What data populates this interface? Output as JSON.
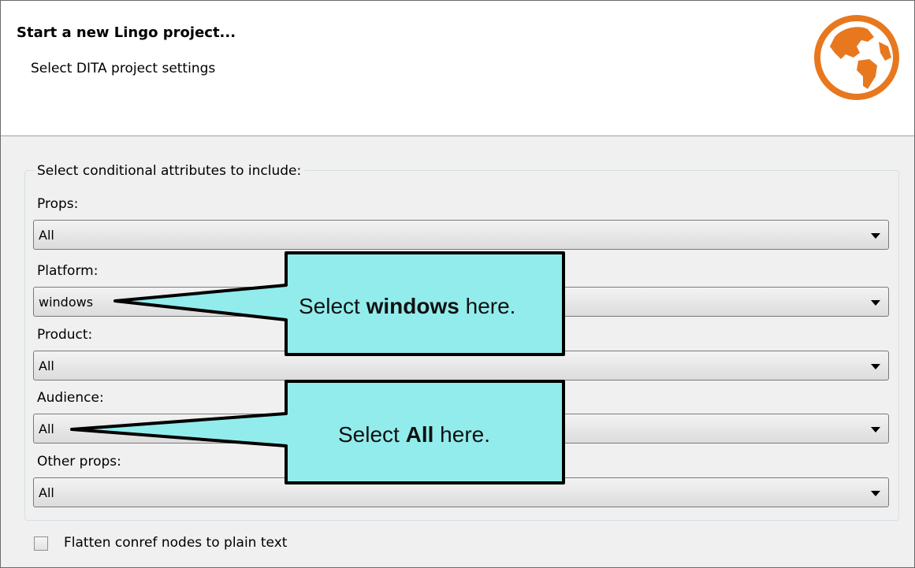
{
  "header": {
    "title": "Start a new Lingo project...",
    "subtitle": "Select DITA project settings",
    "logo_icon": "globe-icon"
  },
  "group": {
    "legend": "Select conditional attributes to include:",
    "fields": [
      {
        "label": "Props:",
        "value": "All"
      },
      {
        "label": "Platform:",
        "value": "windows"
      },
      {
        "label": "Product:",
        "value": "All"
      },
      {
        "label": "Audience:",
        "value": "All"
      },
      {
        "label": "Other props:",
        "value": "All"
      }
    ]
  },
  "flatten": {
    "label": "Flatten conref nodes to plain text",
    "checked": false
  },
  "callouts": [
    {
      "prefix": "Select ",
      "bold": "windows",
      "suffix": " here."
    },
    {
      "prefix": "Select ",
      "bold": "All",
      "suffix": " here."
    }
  ],
  "colors": {
    "callout_fill": "#93ecec",
    "logo_orange": "#e8781e"
  }
}
